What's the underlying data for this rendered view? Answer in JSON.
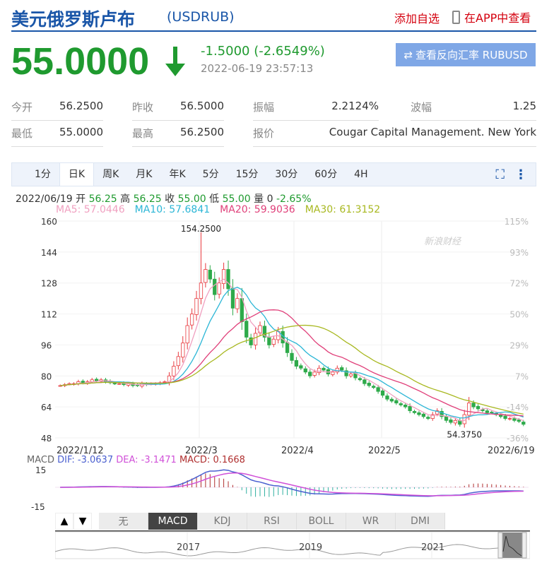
{
  "header": {
    "title": "美元俄罗斯卢布",
    "symbol": "(USDRUB)",
    "add_watch": "添加自选",
    "open_app": "在APP中查看"
  },
  "quote": {
    "price": "55.0000",
    "change": "-1.5000 (-2.6549%)",
    "datetime": "2022-06-19 23:57:13",
    "reverse_button": "查看反向汇率 RUBUSD",
    "direction": "down"
  },
  "stats": [
    {
      "label": "今开",
      "value": "56.2500"
    },
    {
      "label": "昨收",
      "value": "56.5000"
    },
    {
      "label": "振幅",
      "value": "2.2124%"
    },
    {
      "label": "波幅",
      "value": "1.25"
    },
    {
      "label": "最低",
      "value": "55.0000"
    },
    {
      "label": "最高",
      "value": "56.2500"
    },
    {
      "label": "报价",
      "value": "Cougar Capital Management. New York"
    }
  ],
  "tabs": [
    "1分",
    "日K",
    "周K",
    "月K",
    "年K",
    "5分",
    "15分",
    "30分",
    "60分",
    "4H"
  ],
  "active_tab": "日K",
  "ohlc_line": {
    "date": "2022/06/19",
    "open_label": "开",
    "open": "56.25",
    "high_label": "高",
    "high": "56.25",
    "close_label": "收",
    "close": "55.00",
    "low_label": "低",
    "low": "55.00",
    "vol_label": "量",
    "vol": "0",
    "pct": "-2.65%"
  },
  "ma_legend": [
    {
      "text": "MA5: 57.0446",
      "color": "#f0a0c0"
    },
    {
      "text": "MA10: 57.6841",
      "color": "#2bb6d6"
    },
    {
      "text": "MA20: 59.9036",
      "color": "#e0407a"
    },
    {
      "text": "MA30: 61.3152",
      "color": "#a8b820"
    }
  ],
  "watermark": "新浪财经",
  "chart_data": {
    "type": "candlestick",
    "ylim": [
      48,
      160
    ],
    "yticks": [
      "160",
      "144",
      "128",
      "112",
      "96",
      "80",
      "64",
      "48"
    ],
    "right_ticks": [
      "115%",
      "93%",
      "72%",
      "50%",
      "29%",
      "7%",
      "-14%",
      "-36%"
    ],
    "xticks": [
      "2022/1/12",
      "2022/3",
      "2022/4",
      "2022/5",
      "2022/6/19"
    ],
    "max_label": "154.2500",
    "min_label": "54.3750",
    "closes": [
      75,
      75.5,
      76,
      76,
      77,
      76.5,
      77,
      78,
      77.5,
      78,
      77,
      76.5,
      76,
      76,
      75.5,
      76,
      75,
      75,
      76,
      75.5,
      76,
      76,
      76.5,
      77,
      80,
      85,
      90,
      97,
      106,
      112,
      120,
      128,
      135,
      130,
      122,
      128,
      135,
      125,
      115,
      120,
      108,
      100,
      96,
      102,
      106,
      100,
      96,
      99,
      103,
      97,
      92,
      88,
      85,
      84,
      82,
      80,
      82,
      84,
      83,
      81,
      82,
      84,
      83,
      80,
      81,
      79,
      78,
      76,
      75,
      74,
      72,
      70,
      68,
      67,
      66,
      65,
      64,
      62,
      61,
      60,
      59,
      58,
      60,
      62,
      59,
      57,
      56,
      57,
      55,
      60,
      66,
      64,
      63,
      62,
      61,
      61,
      60,
      59,
      58,
      58,
      57,
      56.5,
      55
    ],
    "colors": {
      "up": "#e8383d",
      "down": "#2eaa4a"
    }
  },
  "macd": {
    "label": "MACD",
    "dif": "DIF: -3.0637",
    "dea": "DEA: -3.1471",
    "macd": "MACD: 0.1668",
    "yticks": [
      "15",
      "-15"
    ]
  },
  "indicators": [
    "无",
    "MACD",
    "KDJ",
    "RSI",
    "BOLL",
    "WR",
    "DMI"
  ],
  "active_indicator": "MACD",
  "navigator": {
    "years": [
      "2017",
      "2019",
      "2021"
    ]
  }
}
